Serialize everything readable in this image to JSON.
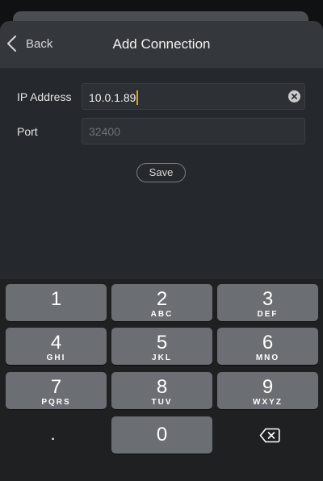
{
  "nav": {
    "back_label": "Back",
    "title": "Add Connection"
  },
  "form": {
    "ip_label": "IP Address",
    "ip_value": "10.0.1.89",
    "port_label": "Port",
    "port_placeholder": "32400",
    "save_label": "Save"
  },
  "colors": {
    "caret": "#e5a00d",
    "key_background": "#6b6e73",
    "sheet_background": "#25282c",
    "nav_background": "#34373c"
  },
  "keypad": {
    "keys": [
      {
        "digit": "1",
        "letters": ""
      },
      {
        "digit": "2",
        "letters": "ABC"
      },
      {
        "digit": "3",
        "letters": "DEF"
      },
      {
        "digit": "4",
        "letters": "GHI"
      },
      {
        "digit": "5",
        "letters": "JKL"
      },
      {
        "digit": "6",
        "letters": "MNO"
      },
      {
        "digit": "7",
        "letters": "PQRS"
      },
      {
        "digit": "8",
        "letters": "TUV"
      },
      {
        "digit": "9",
        "letters": "WXYZ"
      },
      {
        "digit": "0",
        "letters": ""
      }
    ],
    "dot_label": ".",
    "backspace_icon": "delete-left-icon"
  },
  "icons": {
    "back": "chevron-left-icon",
    "clear": "clear-circle-icon"
  }
}
